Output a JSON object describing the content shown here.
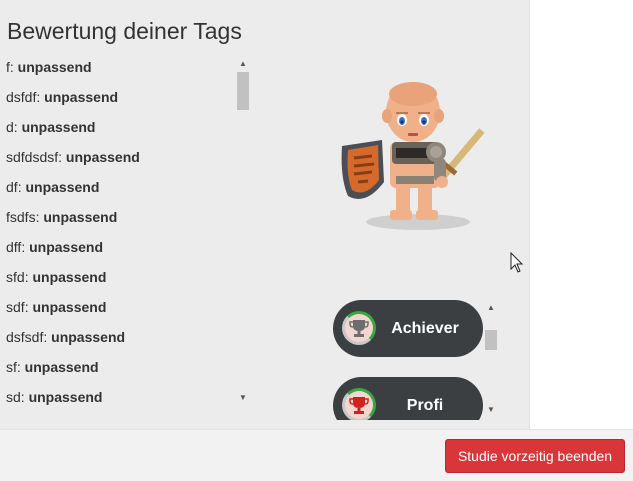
{
  "rating": {
    "title": "Bewertung deiner Tags",
    "tags": [
      {
        "name": "f",
        "value": "unpassend"
      },
      {
        "name": "dsfdf",
        "value": "unpassend"
      },
      {
        "name": "d",
        "value": "unpassend"
      },
      {
        "name": "sdfdsdsf",
        "value": "unpassend"
      },
      {
        "name": "df",
        "value": "unpassend"
      },
      {
        "name": "fsdfs",
        "value": "unpassend"
      },
      {
        "name": "dff",
        "value": "unpassend"
      },
      {
        "name": "sfd",
        "value": "unpassend"
      },
      {
        "name": "sdf",
        "value": "unpassend"
      },
      {
        "name": "dsfsdf",
        "value": "unpassend"
      },
      {
        "name": "sf",
        "value": "unpassend"
      },
      {
        "name": "sd",
        "value": "unpassend"
      }
    ]
  },
  "badges": [
    {
      "label": "Achiever",
      "icon": "trophy-gray-icon"
    },
    {
      "label": "Profi",
      "icon": "trophy-red-icon"
    }
  ],
  "footer": {
    "end_label": "Studie vorzeitig beenden"
  },
  "colors": {
    "panel": "#ececec",
    "badge": "#3b3f42",
    "danger": "#d9363a"
  }
}
